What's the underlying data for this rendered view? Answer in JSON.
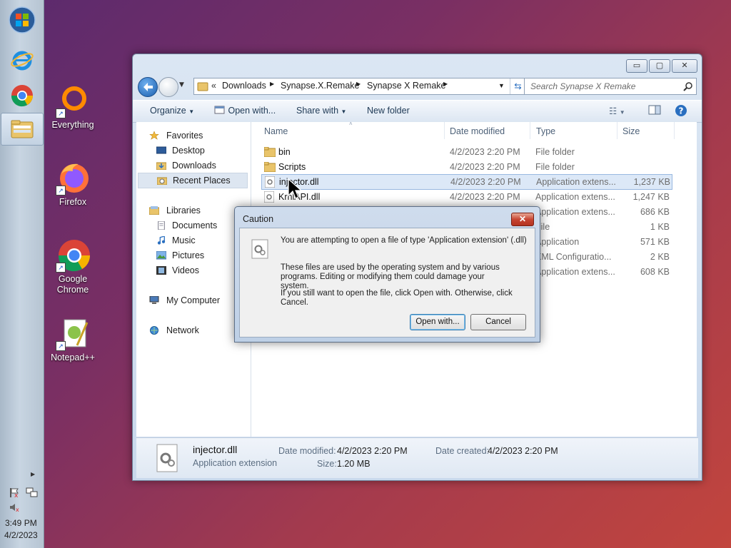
{
  "taskbar": {
    "clock_time": "3:49 PM",
    "clock_date": "4/2/2023"
  },
  "desktop": {
    "icons": [
      {
        "label": "Everything"
      },
      {
        "label": "Firefox"
      },
      {
        "label": "Google Chrome"
      },
      {
        "label": "Notepad++"
      }
    ]
  },
  "explorer": {
    "breadcrumb": {
      "overflow": "«",
      "parts": [
        "Downloads",
        "Synapse.X.Remake",
        "Synapse X Remake"
      ]
    },
    "search_placeholder": "Search Synapse X Remake",
    "commands": {
      "organize": "Organize",
      "open_with": "Open with...",
      "share_with": "Share with",
      "new_folder": "New folder"
    },
    "nav": {
      "favorites": "Favorites",
      "desktop": "Desktop",
      "downloads": "Downloads",
      "recent_places": "Recent Places",
      "libraries": "Libraries",
      "documents": "Documents",
      "music": "Music",
      "pictures": "Pictures",
      "videos": "Videos",
      "my_computer": "My Computer",
      "network": "Network"
    },
    "columns": {
      "name": "Name",
      "date": "Date modified",
      "type": "Type",
      "size": "Size"
    },
    "files": [
      {
        "name": "bin",
        "date": "4/2/2023 2:20 PM",
        "type": "File folder",
        "size": ""
      },
      {
        "name": "Scripts",
        "date": "4/2/2023 2:20 PM",
        "type": "File folder",
        "size": ""
      },
      {
        "name": "injector.dll",
        "date": "4/2/2023 2:20 PM",
        "type": "Application extens...",
        "size": "1,237 KB"
      },
      {
        "name": "KrnlAPI.dll",
        "date": "4/2/2023 2:20 PM",
        "type": "Application extens...",
        "size": "1,247 KB"
      },
      {
        "name": "",
        "date": "",
        "type": "Application extens...",
        "size": "686 KB"
      },
      {
        "name": "",
        "date": "",
        "type": "File",
        "size": "1 KB"
      },
      {
        "name": "",
        "date": "",
        "type": "Application",
        "size": "571 KB"
      },
      {
        "name": "",
        "date": "",
        "type": "XML Configuratio...",
        "size": "2 KB"
      },
      {
        "name": "",
        "date": "",
        "type": "Application extens...",
        "size": "608 KB"
      }
    ],
    "details": {
      "name": "injector.dll",
      "type": "Application extension",
      "modified_label": "Date modified:",
      "modified": "4/2/2023 2:20 PM",
      "created_label": "Date created:",
      "created": "4/2/2023 2:20 PM",
      "size_label": "Size:",
      "size": "1.20 MB"
    }
  },
  "dialog": {
    "title": "Caution",
    "message1": "You are attempting to open a file of type 'Application extension' (.dll)",
    "message2": "These files are used by the operating system and by various programs. Editing or modifying them could damage your system.",
    "message3": "If you still want to open the file, click Open with. Otherwise, click Cancel.",
    "open_with": "Open with...",
    "cancel": "Cancel"
  }
}
